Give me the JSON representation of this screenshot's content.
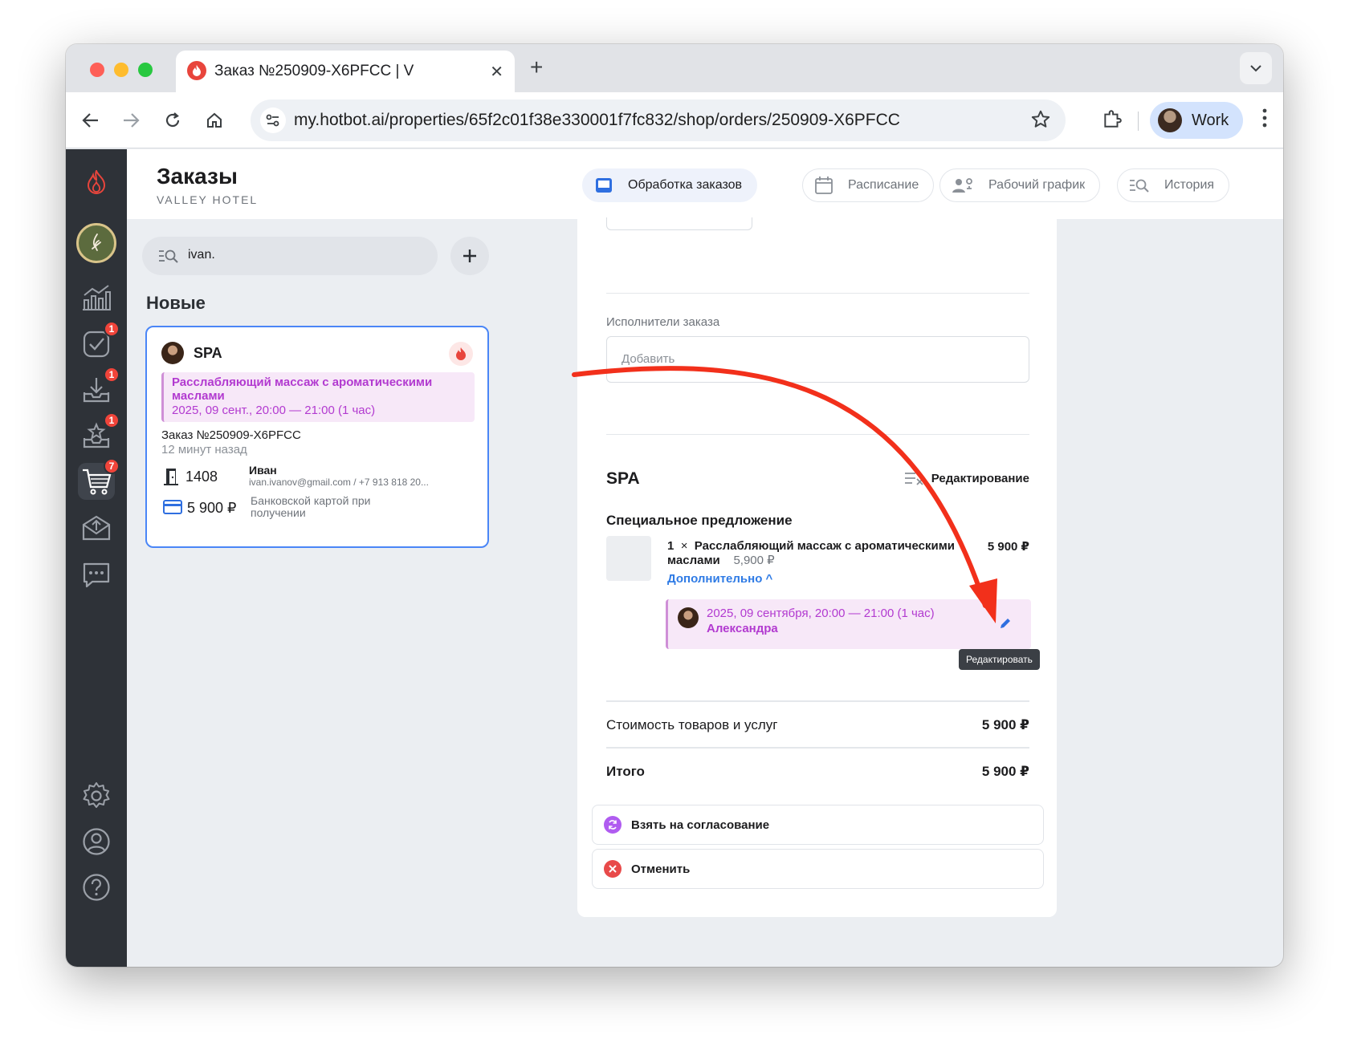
{
  "browser": {
    "tab_title": "Заказ №250909-X6PFCC | V",
    "url": "my.hotbot.ai/properties/65f2c01f38e330001f7fc832/shop/orders/250909-X6PFCC",
    "profile_label": "Work"
  },
  "sidebar": {
    "badges": {
      "tasks": "1",
      "inbox": "1",
      "reviews": "1",
      "shop": "7"
    }
  },
  "header": {
    "title": "Заказы",
    "subtitle": "VALLEY HOTEL",
    "tabs": [
      {
        "label": "Обработка заказов",
        "icon": "inbox-icon",
        "active": true
      },
      {
        "label": "Расписание",
        "icon": "calendar-icon",
        "active": false
      },
      {
        "label": "Рабочий график",
        "icon": "staff-settings-icon",
        "active": false
      },
      {
        "label": "История",
        "icon": "history-search-icon",
        "active": false
      }
    ]
  },
  "list": {
    "search_value": "ivan.",
    "section_title": "Новые",
    "card": {
      "title": "SPA",
      "service_name": "Расслабляющий массаж с ароматическими маслами",
      "service_date": "2025, 09 сент., 20:00 — 21:00  (1 час)",
      "order_no": "Заказ №250909-X6PFCC",
      "time_ago": "12 минут назад",
      "room": "1408",
      "guest_name": "Иван",
      "guest_contact": "ivan.ivanov@gmail.com / +7 913 818 20...",
      "price": "5 900 ₽",
      "payment": "Банковской картой при получении"
    }
  },
  "detail": {
    "assignees_label": "Исполнители заказа",
    "assignees_placeholder": "Добавить",
    "section_title": "SPA",
    "edit_label": "Редактирование",
    "offer_title": "Специальное предложение",
    "item": {
      "qty": "1",
      "times": "×",
      "name": "Расслабляющий массаж с ароматическими маслами",
      "unit_price": "5,900 ₽",
      "total": "5 900 ₽",
      "extra_label": "Дополнительно ^"
    },
    "booking": {
      "date": "2025, 09 сентября, 20:00 — 21:00  (1 час)",
      "staff": "Александра",
      "tooltip": "Редактировать"
    },
    "subtotal_label": "Стоимость товаров и услуг",
    "subtotal_value": "5 900 ₽",
    "total_label": "Итого",
    "total_value": "5 900 ₽",
    "actions": [
      {
        "label": "Взять на согласование",
        "icon": "sync-icon",
        "color": "#b05cf0"
      },
      {
        "label": "Отменить",
        "icon": "cancel-icon",
        "color": "#e84a4a"
      }
    ]
  },
  "annotation": {
    "arrow_color": "#f2301b"
  }
}
